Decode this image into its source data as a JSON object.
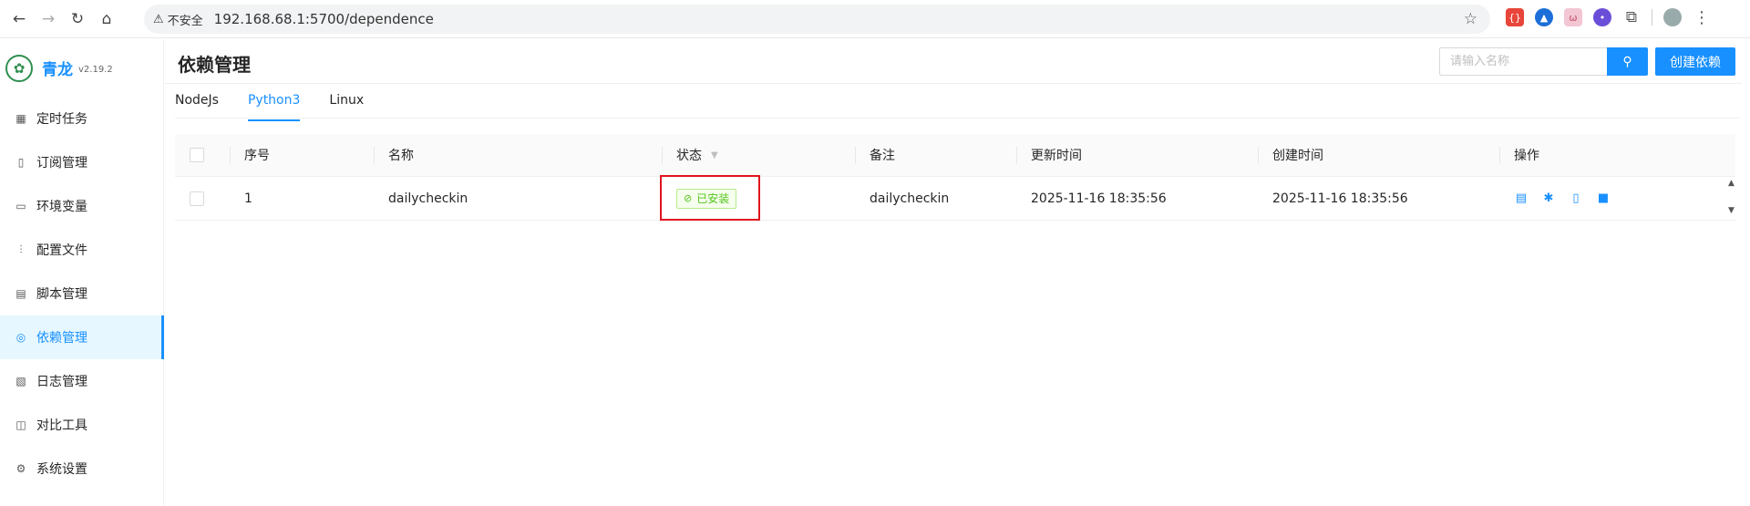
{
  "browser": {
    "insecure_label": "不安全",
    "url": "192.168.68.1:5700/dependence"
  },
  "app": {
    "name": "青龙",
    "version": "v2.19.2"
  },
  "sidebar": {
    "items": [
      {
        "label": "定时任务",
        "icon": "calendar-icon"
      },
      {
        "label": "订阅管理",
        "icon": "subscription-icon"
      },
      {
        "label": "环境变量",
        "icon": "monitor-icon"
      },
      {
        "label": "配置文件",
        "icon": "sliders-icon"
      },
      {
        "label": "脚本管理",
        "icon": "script-icon"
      },
      {
        "label": "依赖管理",
        "icon": "dependence-icon",
        "active": true
      },
      {
        "label": "日志管理",
        "icon": "log-icon"
      },
      {
        "label": "对比工具",
        "icon": "diff-icon"
      },
      {
        "label": "系统设置",
        "icon": "gear-icon"
      }
    ]
  },
  "header": {
    "title": "依赖管理",
    "search_placeholder": "请输入名称",
    "create_label": "创建依赖"
  },
  "tabs": [
    {
      "label": "NodeJs"
    },
    {
      "label": "Python3",
      "active": true
    },
    {
      "label": "Linux"
    }
  ],
  "table": {
    "columns": [
      "序号",
      "名称",
      "状态",
      "备注",
      "更新时间",
      "创建时间",
      "操作"
    ],
    "rows": [
      {
        "index": "1",
        "name": "dailycheckin",
        "status": "已安装",
        "remark": "dailycheckin",
        "updated": "2025-11-16 18:35:56",
        "created": "2025-11-16 18:35:56"
      }
    ]
  },
  "colors": {
    "accent": "#1890ff",
    "success": "#52c41a",
    "highlight_box": "#e0141e"
  }
}
